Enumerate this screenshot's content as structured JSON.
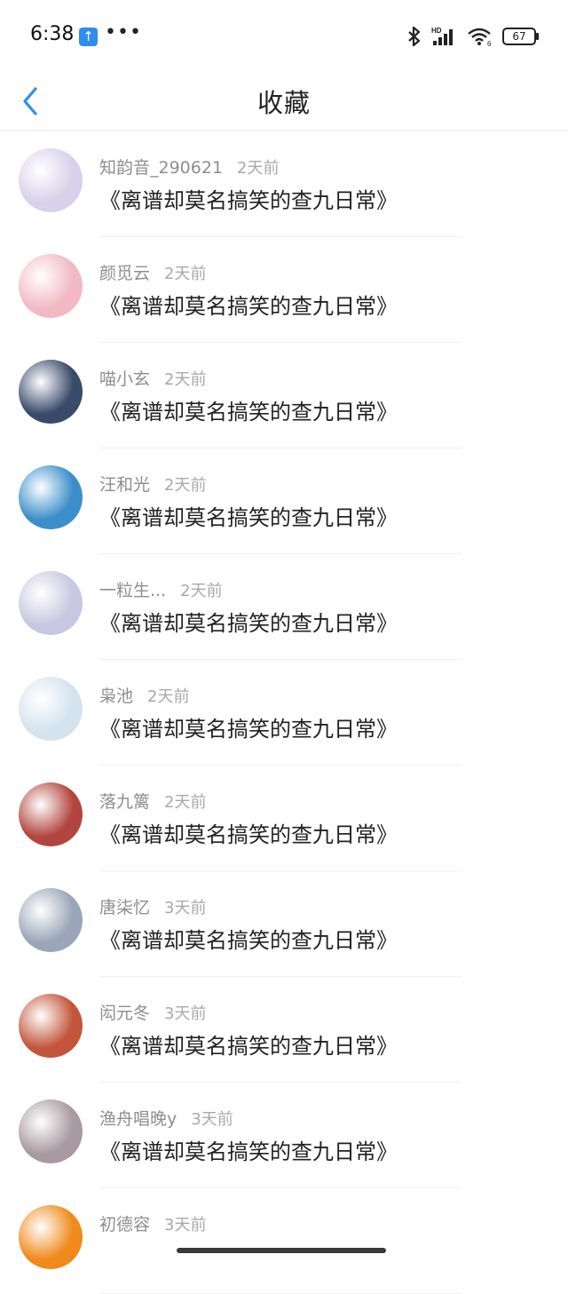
{
  "status_bar": {
    "time": "6:38",
    "upload_badge": "↑",
    "more": "•••",
    "battery": "67"
  },
  "header": {
    "title": "收藏"
  },
  "favorites": [
    {
      "name": "知韵音_290621",
      "time": "2天前",
      "content": "《离谱却莫名搞笑的查九日常》",
      "avatar_color": "#d8d1ea"
    },
    {
      "name": "颜觅云",
      "time": "2天前",
      "content": "《离谱却莫名搞笑的查九日常》",
      "avatar_color": "#f2b9c4"
    },
    {
      "name": "喵小玄",
      "time": "2天前",
      "content": "《离谱却莫名搞笑的查九日常》",
      "avatar_color": "#3a4a6b"
    },
    {
      "name": "汪和光",
      "time": "2天前",
      "content": "《离谱却莫名搞笑的查九日常》",
      "avatar_color": "#3b8ec9"
    },
    {
      "name": "一粒生...",
      "time": "2天前",
      "content": "《离谱却莫名搞笑的查九日常》",
      "avatar_color": "#c9c7e0"
    },
    {
      "name": "枭池",
      "time": "2天前",
      "content": "《离谱却莫名搞笑的查九日常》",
      "avatar_color": "#d5e3ef"
    },
    {
      "name": "落九篱",
      "time": "2天前",
      "content": "《离谱却莫名搞笑的查九日常》",
      "avatar_color": "#b2463f"
    },
    {
      "name": "唐柒忆",
      "time": "3天前",
      "content": "《离谱却莫名搞笑的查九日常》",
      "avatar_color": "#9aa6b8"
    },
    {
      "name": "闳元冬",
      "time": "3天前",
      "content": "《离谱却莫名搞笑的查九日常》",
      "avatar_color": "#c2553a"
    },
    {
      "name": "渔舟唱晚y",
      "time": "3天前",
      "content": "《离谱却莫名搞笑的查九日常》",
      "avatar_color": "#a89aa0"
    },
    {
      "name": "初德容",
      "time": "3天前",
      "content": "",
      "avatar_color": "#f08a1c"
    }
  ]
}
